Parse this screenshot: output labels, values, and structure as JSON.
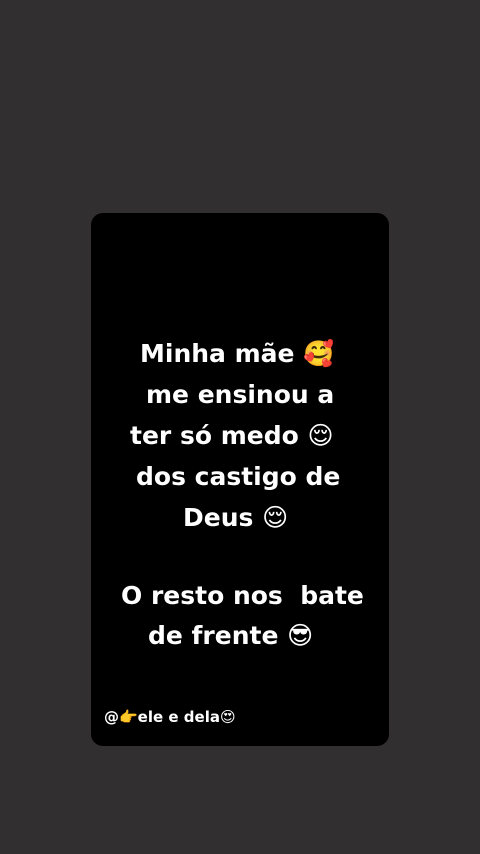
{
  "quote": {
    "line1": "Minha mãe 🥰",
    "line2": "me ensinou a",
    "line3": "ter só medo 😌",
    "line4": "dos castigo de",
    "line5": "Deus 😌",
    "line6": "O resto nos  bate",
    "line7": "de frente 😎"
  },
  "watermark": "@👉ele e dela😍",
  "colors": {
    "background": "#322f30",
    "card": "#000000",
    "text": "#ffffff"
  }
}
